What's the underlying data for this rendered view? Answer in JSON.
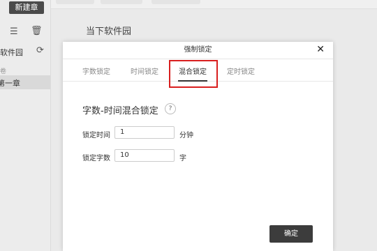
{
  "sidebar": {
    "new_chapter_label": "新建章",
    "book_name": "软件园",
    "volume_label": "卷",
    "selected_chapter": "第一章"
  },
  "editor": {
    "title": "当下软件园"
  },
  "dialog": {
    "title": "强制锁定",
    "close_glyph": "✕",
    "tabs": [
      {
        "label": "字数锁定"
      },
      {
        "label": "时间锁定"
      },
      {
        "label": "混合锁定"
      },
      {
        "label": "定时锁定"
      }
    ],
    "active_tab": "混合锁定",
    "section_title": "字数-时间混合锁定",
    "help_glyph": "?",
    "fields": [
      {
        "label": "锁定时间",
        "value": "1",
        "unit": "分钟"
      },
      {
        "label": "锁定字数",
        "value": "10",
        "unit": "字"
      }
    ],
    "confirm_label": "确定"
  },
  "colors": {
    "highlight": "#d81e1e",
    "button_dark": "#3c3c3c"
  }
}
